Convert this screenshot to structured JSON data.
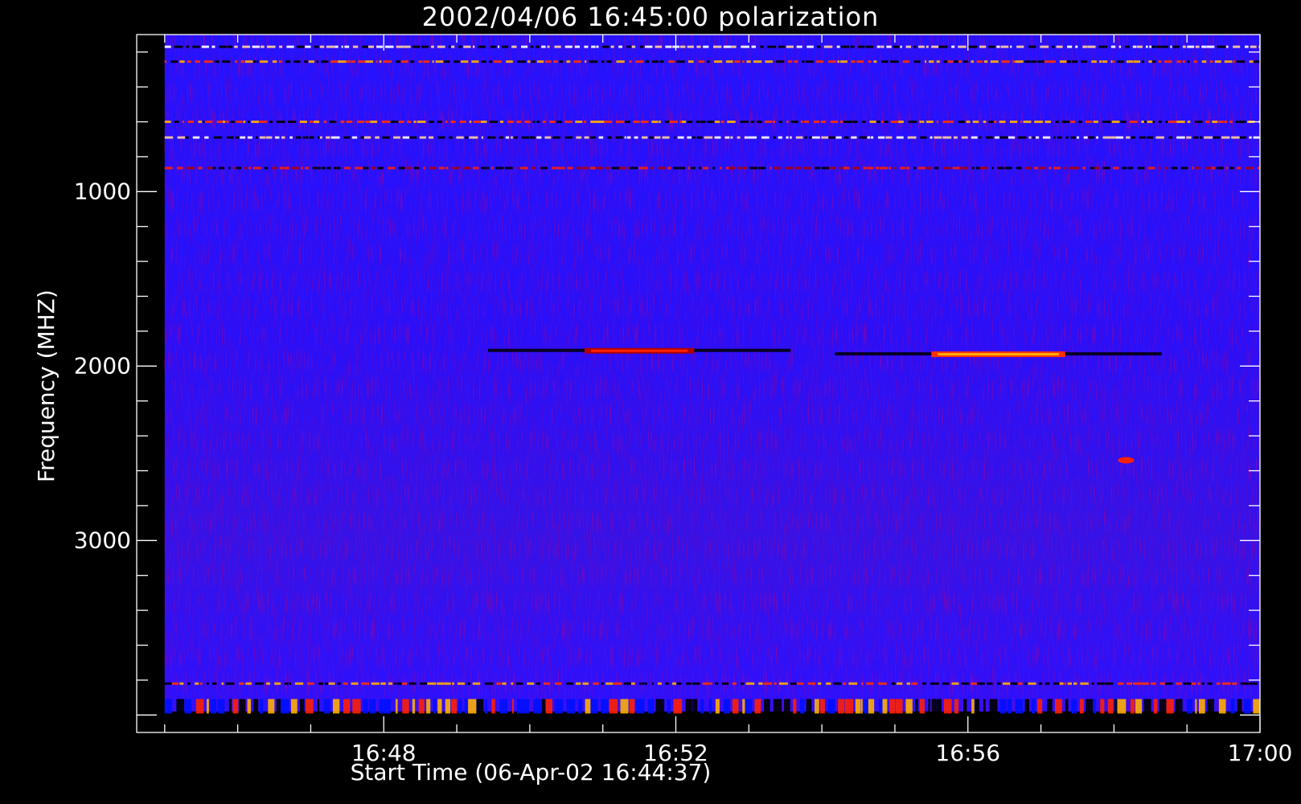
{
  "chart_data": {
    "type": "heatmap",
    "title": "2002/04/06 16:45:00 polarization",
    "xlabel": "Start Time (06-Apr-02 16:44:37)",
    "ylabel": "Frequency (MHZ)",
    "x_ticks": [
      "16:48",
      "16:52",
      "16:56",
      "17:00"
    ],
    "y_ticks": [
      "1000",
      "2000",
      "3000"
    ],
    "x_range": [
      "16:44:37",
      "17:00:00"
    ],
    "y_range": [
      4100,
      100
    ],
    "data_x_range": [
      "16:45:00",
      "17:00:00"
    ],
    "data_y_range": [
      100,
      3980
    ],
    "colormap": [
      "#000000",
      "#1a00ff",
      "#ff2000",
      "#ffb000",
      "#ffffff"
    ],
    "background_color": "#2a10ff",
    "features": [
      {
        "kind": "band",
        "freq_mhz": 170,
        "intensity": "white"
      },
      {
        "kind": "band",
        "freq_mhz": 255,
        "intensity": "orange"
      },
      {
        "kind": "band",
        "freq_mhz": 600,
        "intensity": "orange"
      },
      {
        "kind": "band",
        "freq_mhz": 690,
        "intensity": "white"
      },
      {
        "kind": "band",
        "freq_mhz": 865,
        "intensity": "red"
      },
      {
        "kind": "burst",
        "freq_mhz": 1910,
        "t_start": "16:50:45",
        "t_end": "16:52:15",
        "intensity": "red"
      },
      {
        "kind": "burst",
        "freq_mhz": 1930,
        "t_start": "16:55:30",
        "t_end": "16:57:20",
        "intensity": "orange"
      },
      {
        "kind": "spot",
        "freq_mhz": 2540,
        "t": "16:58:10",
        "intensity": "red"
      },
      {
        "kind": "band",
        "freq_mhz": 3820,
        "intensity": "orange"
      },
      {
        "kind": "band",
        "freq_mhz": 3950,
        "intensity": "mixed"
      }
    ]
  }
}
